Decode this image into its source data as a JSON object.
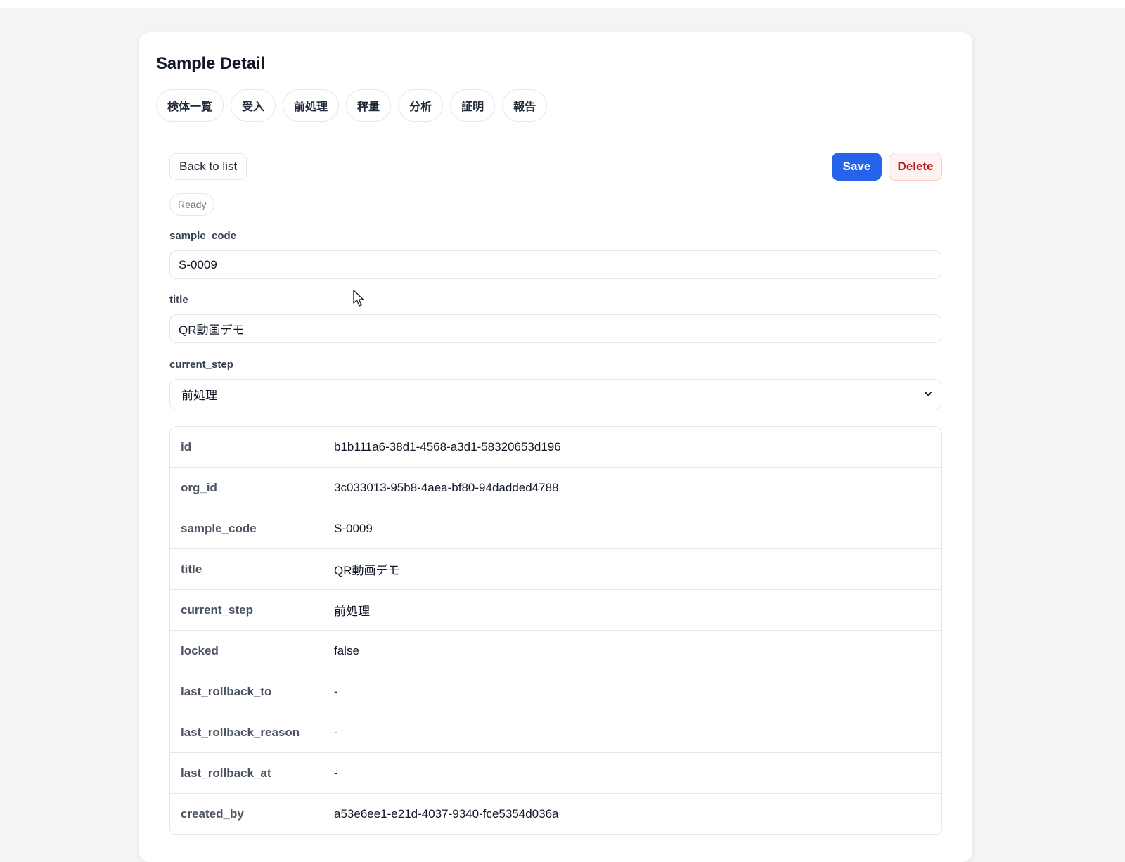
{
  "page": {
    "title": "Sample Detail"
  },
  "tabs": [
    {
      "label": "検体一覧"
    },
    {
      "label": "受入"
    },
    {
      "label": "前処理"
    },
    {
      "label": "秤量"
    },
    {
      "label": "分析"
    },
    {
      "label": "証明"
    },
    {
      "label": "報告"
    }
  ],
  "actions": {
    "back_label": "Back to list",
    "save_label": "Save",
    "delete_label": "Delete"
  },
  "status": {
    "text": "Ready"
  },
  "form": {
    "sample_code": {
      "label": "sample_code",
      "value": "S-0009"
    },
    "title": {
      "label": "title",
      "value": "QR動画デモ"
    },
    "current_step": {
      "label": "current_step",
      "value": "前処理"
    }
  },
  "details": [
    {
      "key": "id",
      "value": "b1b111a6-38d1-4568-a3d1-58320653d196"
    },
    {
      "key": "org_id",
      "value": "3c033013-95b8-4aea-bf80-94dadded4788"
    },
    {
      "key": "sample_code",
      "value": "S-0009"
    },
    {
      "key": "title",
      "value": "QR動画デモ"
    },
    {
      "key": "current_step",
      "value": "前処理"
    },
    {
      "key": "locked",
      "value": "false"
    },
    {
      "key": "last_rollback_to",
      "value": "-"
    },
    {
      "key": "last_rollback_reason",
      "value": "-"
    },
    {
      "key": "last_rollback_at",
      "value": "-"
    },
    {
      "key": "created_by",
      "value": "a53e6ee1-e21d-4037-9340-fce5354d036a"
    }
  ],
  "colors": {
    "primary": "#2563eb",
    "danger": "#b91c1c",
    "danger_bg": "#fef2f2",
    "page_bg": "#f3f4f6"
  },
  "icons": {
    "select_arrow": "chevron-down-icon",
    "pointer": "mouse-cursor-icon"
  }
}
